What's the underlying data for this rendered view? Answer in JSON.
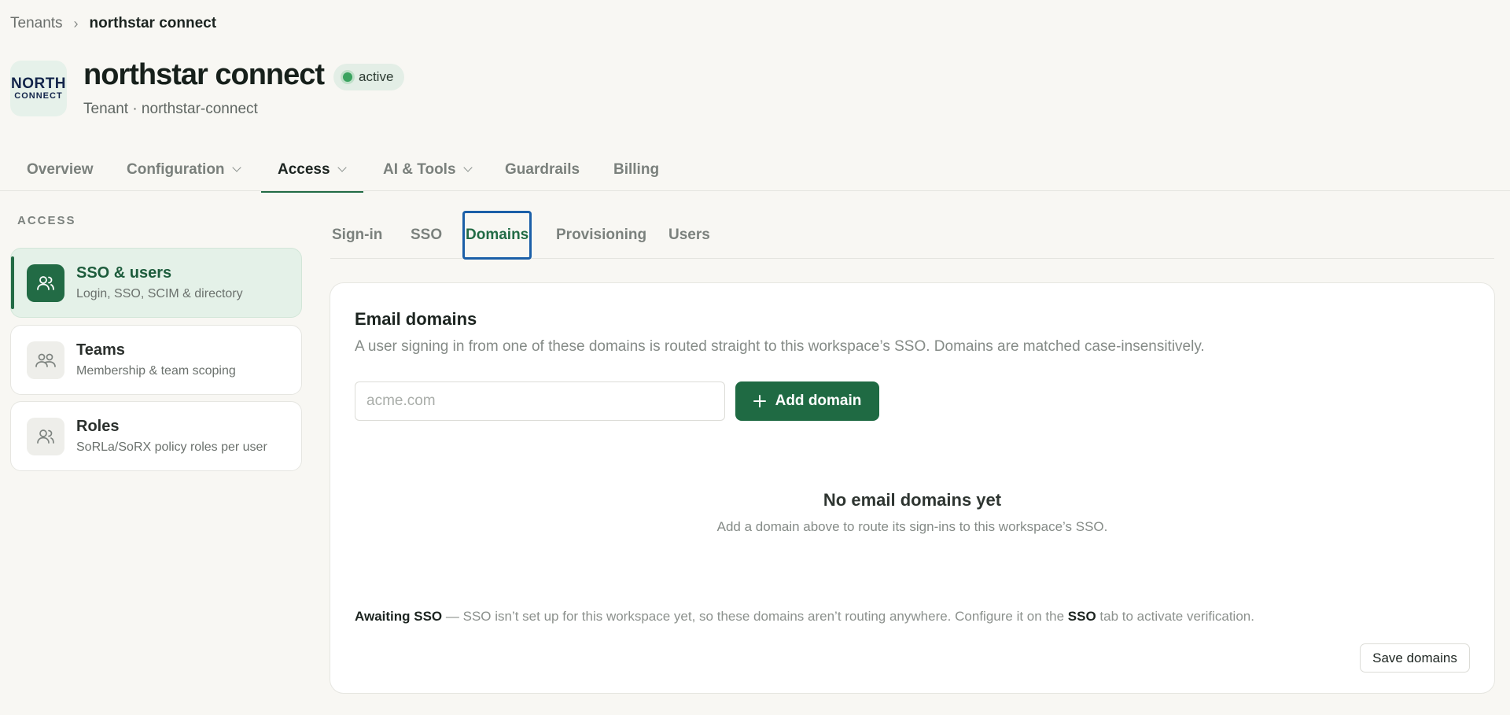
{
  "breadcrumb": {
    "root": "Tenants",
    "separator": "›",
    "current": "northstar connect"
  },
  "header": {
    "logo_line1": "NORTH",
    "logo_line2": "CONNECT",
    "title": "northstar connect",
    "status": "active",
    "subtitle": "Tenant · northstar-connect"
  },
  "top_tabs": [
    {
      "label": "Overview",
      "has_menu": false,
      "active": false
    },
    {
      "label": "Configuration",
      "has_menu": true,
      "active": false
    },
    {
      "label": "Access",
      "has_menu": true,
      "active": true
    },
    {
      "label": "AI & Tools",
      "has_menu": true,
      "active": false
    },
    {
      "label": "Guardrails",
      "has_menu": false,
      "active": false
    },
    {
      "label": "Billing",
      "has_menu": false,
      "active": false
    }
  ],
  "sidebar": {
    "heading": "ACCESS",
    "items": [
      {
        "title": "SSO & users",
        "desc": "Login, SSO, SCIM & directory",
        "icon": "user-icon",
        "active": true
      },
      {
        "title": "Teams",
        "desc": "Membership & team scoping",
        "icon": "team-icon",
        "active": false
      },
      {
        "title": "Roles",
        "desc": "SoRLa/SoRX policy roles per user",
        "icon": "user-icon",
        "active": false
      }
    ]
  },
  "sub_tabs": [
    {
      "label": "Sign-in",
      "active": false
    },
    {
      "label": "SSO",
      "active": false
    },
    {
      "label": "Domains",
      "active": true
    },
    {
      "label": "Provisioning",
      "active": false
    },
    {
      "label": "Users",
      "active": false
    }
  ],
  "domains": {
    "title": "Email domains",
    "description": "A user signing in from one of these domains is routed straight to this workspace’s SSO. Domains are matched case-insensitively.",
    "input_value": "",
    "input_placeholder": "acme.com",
    "add_button": "Add domain",
    "empty_title": "No email domains yet",
    "empty_desc": "Add a domain above to route its sign-ins to this workspace’s SSO.",
    "notice_strong": "Awaiting SSO",
    "notice_text": " — SSO isn’t set up for this workspace yet, so these domains aren’t routing anywhere. Configure it on the ",
    "notice_link": "SSO",
    "notice_tail": " tab to activate verification.",
    "save_button": "Save domains"
  },
  "colors": {
    "accent": "#226b45",
    "focus_ring": "#1b5fa8",
    "status_dot": "#3aa35f",
    "background": "#f8f7f3"
  }
}
